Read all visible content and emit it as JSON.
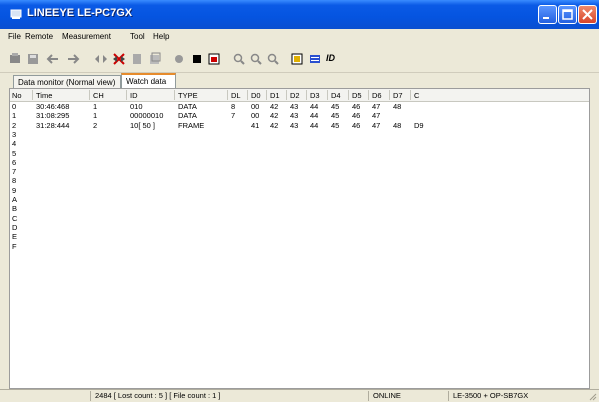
{
  "window": {
    "title": "LINEEYE LE-PC7GX"
  },
  "menu": [
    "File",
    "Remote",
    "Measurement",
    "Tool",
    "Help"
  ],
  "toolbar": {
    "icons": [
      "new-icon",
      "save-icon",
      "back-icon",
      "forward-icon",
      "record-icon",
      "cross-icon",
      "print-icon",
      "copy-icon",
      "circle-icon",
      "stop-icon",
      "setup-icon",
      "zoom-in-icon",
      "zoom-out-icon",
      "zoom-reset-icon",
      "window-icon",
      "grid-icon"
    ],
    "id_label": "ID"
  },
  "tabs": [
    {
      "label": "Data monitor (Normal view)",
      "active": false
    },
    {
      "label": "Watch data",
      "active": true
    }
  ],
  "table": {
    "columns": [
      "No",
      "Time",
      "CH",
      "ID",
      "TYPE",
      "DL",
      "D0",
      "D1",
      "D2",
      "D3",
      "D4",
      "D5",
      "D6",
      "D7",
      "C"
    ],
    "rows": [
      [
        "0",
        "30:46:468",
        "1",
        "010",
        "DATA",
        "8",
        "00",
        "42",
        "43",
        "44",
        "45",
        "46",
        "47",
        "48",
        ""
      ],
      [
        "1",
        "31:08:295",
        "1",
        "00000010",
        "DATA",
        "7",
        "00",
        "42",
        "43",
        "44",
        "45",
        "46",
        "47",
        "",
        ""
      ],
      [
        "2",
        "31:28:444",
        "2",
        "10[ 50 ]",
        "FRAME",
        "",
        "41",
        "42",
        "43",
        "44",
        "45",
        "46",
        "47",
        "48",
        "D9"
      ],
      [
        "3",
        "",
        "",
        "",
        "",
        "",
        "",
        "",
        "",
        "",
        "",
        "",
        "",
        "",
        ""
      ],
      [
        "4",
        "",
        "",
        "",
        "",
        "",
        "",
        "",
        "",
        "",
        "",
        "",
        "",
        "",
        ""
      ],
      [
        "5",
        "",
        "",
        "",
        "",
        "",
        "",
        "",
        "",
        "",
        "",
        "",
        "",
        "",
        ""
      ],
      [
        "6",
        "",
        "",
        "",
        "",
        "",
        "",
        "",
        "",
        "",
        "",
        "",
        "",
        "",
        ""
      ],
      [
        "7",
        "",
        "",
        "",
        "",
        "",
        "",
        "",
        "",
        "",
        "",
        "",
        "",
        "",
        ""
      ],
      [
        "8",
        "",
        "",
        "",
        "",
        "",
        "",
        "",
        "",
        "",
        "",
        "",
        "",
        "",
        ""
      ],
      [
        "9",
        "",
        "",
        "",
        "",
        "",
        "",
        "",
        "",
        "",
        "",
        "",
        "",
        "",
        ""
      ],
      [
        "A",
        "",
        "",
        "",
        "",
        "",
        "",
        "",
        "",
        "",
        "",
        "",
        "",
        "",
        ""
      ],
      [
        "B",
        "",
        "",
        "",
        "",
        "",
        "",
        "",
        "",
        "",
        "",
        "",
        "",
        "",
        ""
      ],
      [
        "C",
        "",
        "",
        "",
        "",
        "",
        "",
        "",
        "",
        "",
        "",
        "",
        "",
        "",
        ""
      ],
      [
        "D",
        "",
        "",
        "",
        "",
        "",
        "",
        "",
        "",
        "",
        "",
        "",
        "",
        "",
        ""
      ],
      [
        "E",
        "",
        "",
        "",
        "",
        "",
        "",
        "",
        "",
        "",
        "",
        "",
        "",
        "",
        ""
      ],
      [
        "F",
        "",
        "",
        "",
        "",
        "",
        "",
        "",
        "",
        "",
        "",
        "",
        "",
        "",
        ""
      ]
    ]
  },
  "status": {
    "count": "2484 [ Lost count : 5 ] [ File count : 1 ]",
    "connection": "ONLINE",
    "device": "LE-3500 + OP-SB7GX"
  }
}
